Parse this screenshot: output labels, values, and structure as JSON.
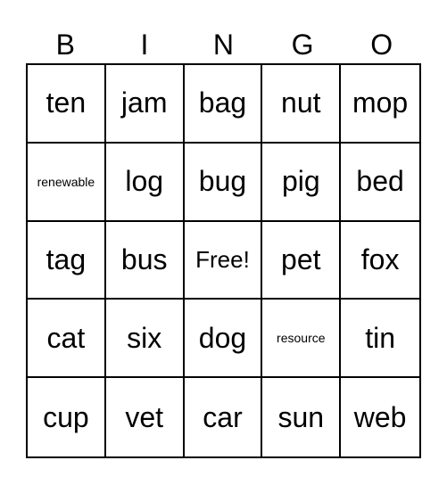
{
  "header": [
    "B",
    "I",
    "N",
    "G",
    "O"
  ],
  "cells": [
    "ten",
    "jam",
    "bag",
    "nut",
    "mop",
    "renewable",
    "log",
    "bug",
    "pig",
    "bed",
    "tag",
    "bus",
    "Free!",
    "pet",
    "fox",
    "cat",
    "six",
    "dog",
    "resource",
    "tin",
    "cup",
    "vet",
    "car",
    "sun",
    "web"
  ]
}
